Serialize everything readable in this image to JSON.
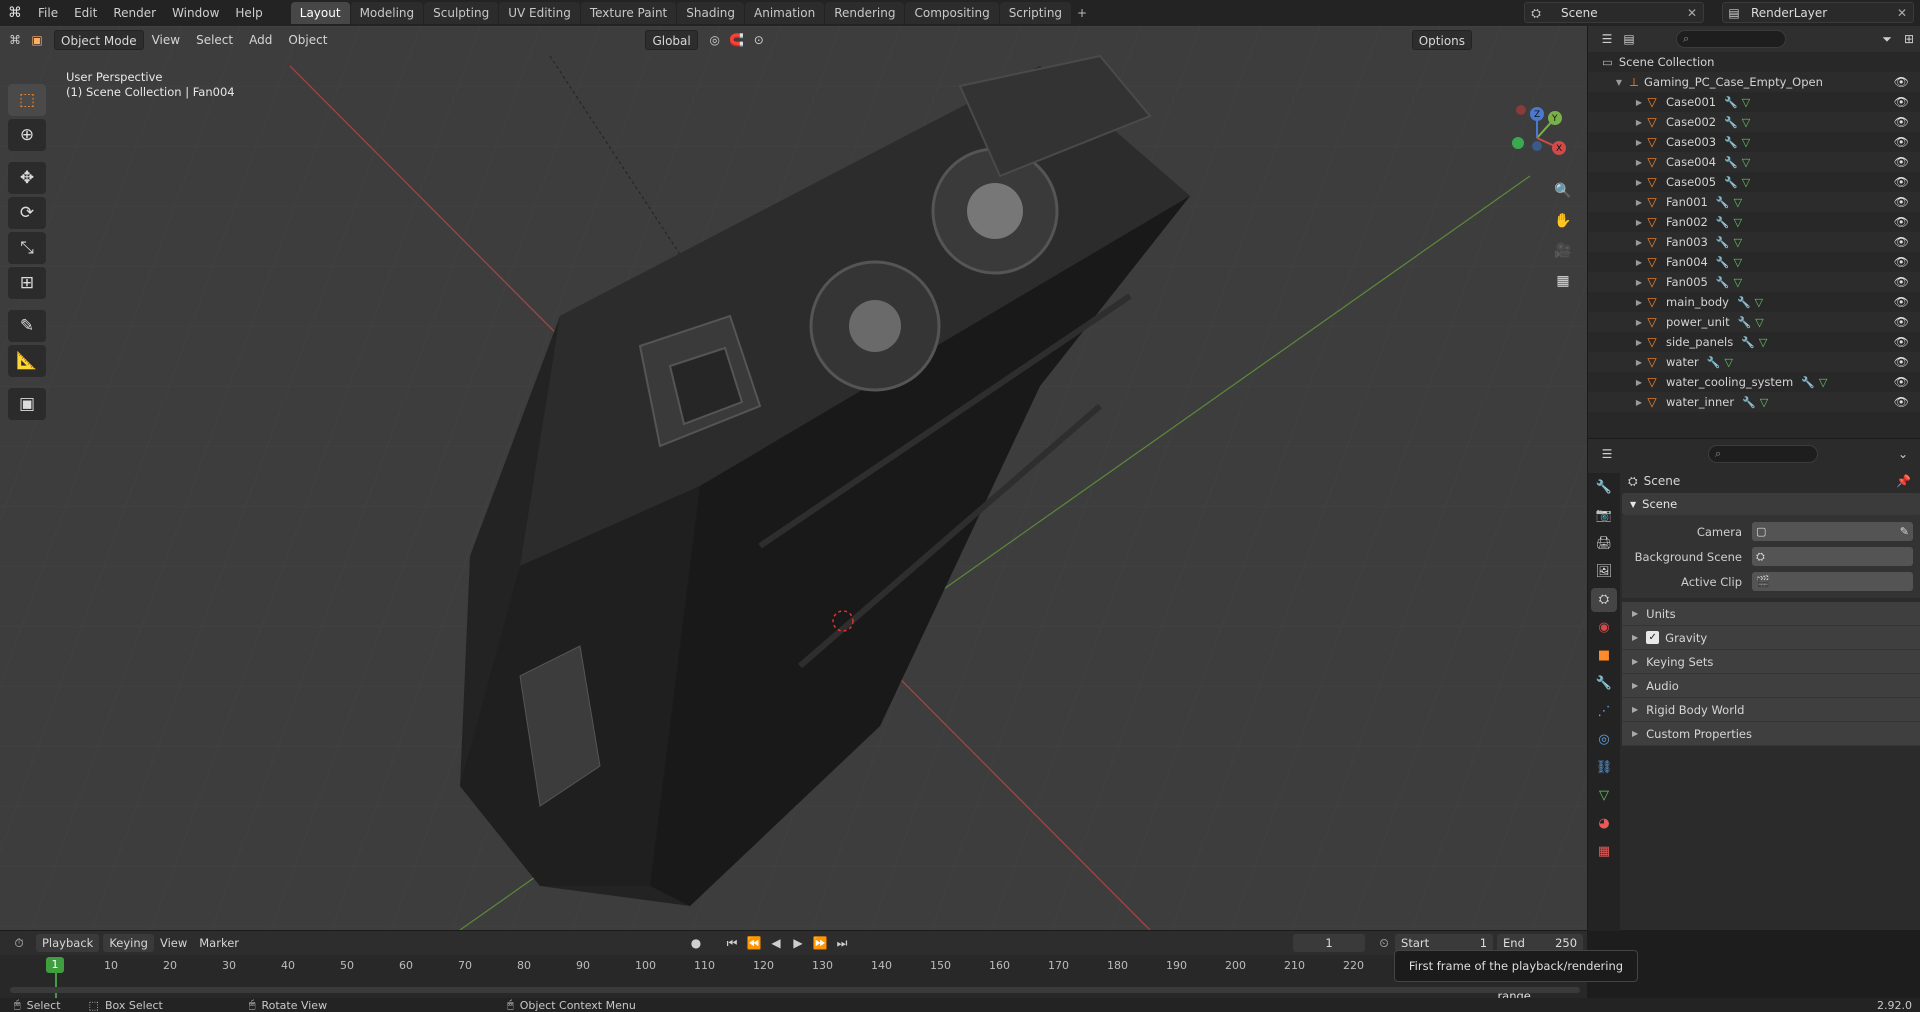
{
  "menu": [
    "File",
    "Edit",
    "Render",
    "Window",
    "Help"
  ],
  "workspaces": [
    "Layout",
    "Modeling",
    "Sculpting",
    "UV Editing",
    "Texture Paint",
    "Shading",
    "Animation",
    "Rendering",
    "Compositing",
    "Scripting"
  ],
  "active_workspace": "Layout",
  "scene_name": "Scene",
  "view_layer": "RenderLayer",
  "viewport": {
    "mode": "Object Mode",
    "menus": [
      "View",
      "Select",
      "Add",
      "Object"
    ],
    "transform": "Global",
    "options": "Options",
    "perspective": "User Perspective",
    "context": "(1) Scene Collection | Fan004"
  },
  "outliner": {
    "root": "Scene Collection",
    "collection": "Gaming_PC_Case_Empty_Open",
    "items": [
      "Case001",
      "Case002",
      "Case003",
      "Case004",
      "Case005",
      "Fan001",
      "Fan002",
      "Fan003",
      "Fan004",
      "Fan005",
      "main_body",
      "power_unit",
      "side_panels",
      "water",
      "water_cooling_system",
      "water_inner"
    ]
  },
  "properties": {
    "context": "Scene",
    "panel": "Scene",
    "fields": [
      {
        "label": "Camera",
        "value": ""
      },
      {
        "label": "Background Scene",
        "value": ""
      },
      {
        "label": "Active Clip",
        "value": ""
      }
    ],
    "subpanels": [
      "Units",
      "Gravity",
      "Keying Sets",
      "Audio",
      "Rigid Body World",
      "Custom Properties"
    ],
    "gravity_checked": true
  },
  "timeline": {
    "menus": [
      "Playback",
      "Keying",
      "View",
      "Marker"
    ],
    "current_frame": "1",
    "frame_field": "1",
    "start_label": "Start",
    "start": "1",
    "end_label": "End",
    "end": "250",
    "ticks": [
      "10",
      "20",
      "30",
      "40",
      "50",
      "60",
      "70",
      "80",
      "90",
      "100",
      "110",
      "120",
      "130",
      "140",
      "150",
      "160",
      "170",
      "180",
      "190",
      "200",
      "210",
      "220"
    ],
    "tooltip": "First frame of the playback/rendering range."
  },
  "status": {
    "select": "Select",
    "box_select": "Box Select",
    "rotate": "Rotate View",
    "context_menu": "Object Context Menu",
    "version": "2.92.0"
  }
}
